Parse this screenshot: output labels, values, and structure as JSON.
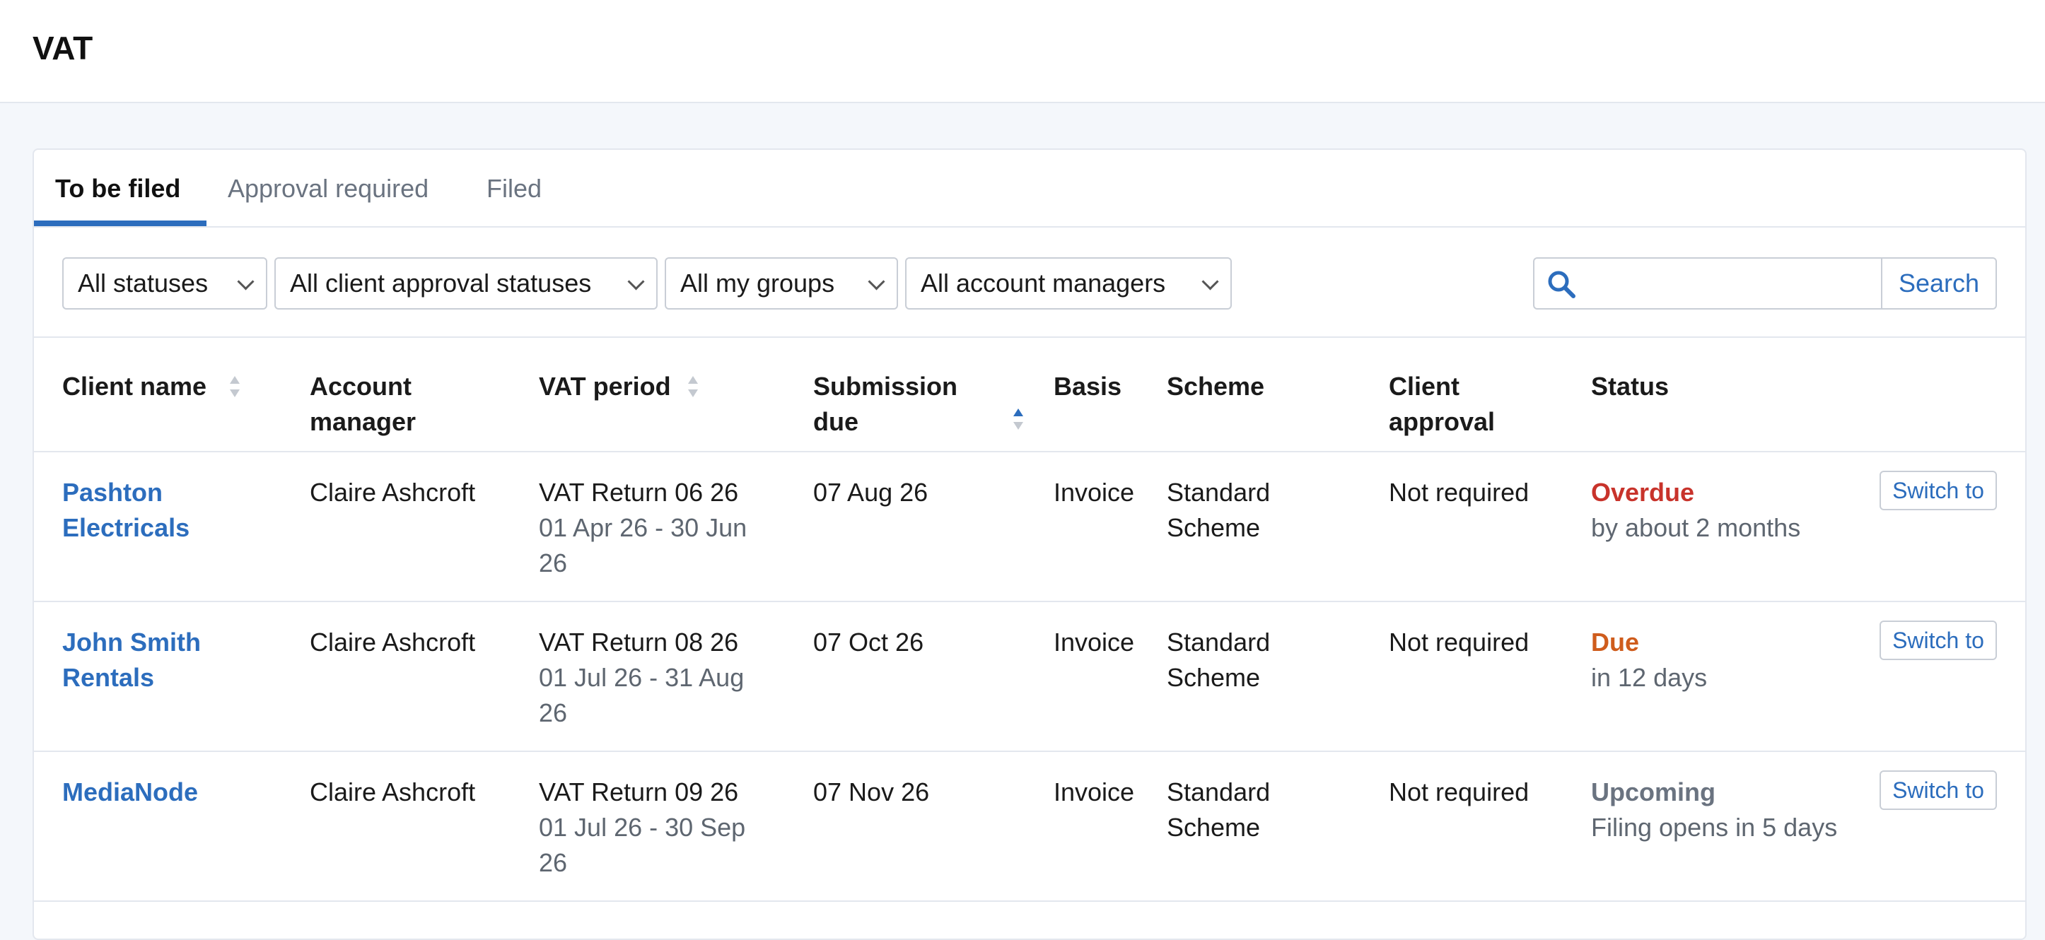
{
  "page": {
    "title": "VAT"
  },
  "tabs": [
    {
      "label": "To be filed",
      "active": true
    },
    {
      "label": "Approval required",
      "active": false
    },
    {
      "label": "Filed",
      "active": false
    }
  ],
  "filters": {
    "status": "All statuses",
    "client_approval": "All client approval statuses",
    "groups": "All my groups",
    "account_managers": "All account managers"
  },
  "search": {
    "value": "",
    "placeholder": "",
    "button_label": "Search"
  },
  "table": {
    "columns": {
      "client_name": "Client name",
      "account_manager": "Account manager",
      "vat_period": "VAT period",
      "submission_due": "Submission due",
      "basis": "Basis",
      "scheme": "Scheme",
      "client_approval": "Client approval",
      "status": "Status"
    },
    "sorted_column": "submission_due",
    "rows": [
      {
        "client": "Pashton Electricals",
        "manager": "Claire Ashcroft",
        "vat_return": "VAT Return 06 26",
        "period": "01 Apr 26 - 30 Jun 26",
        "due": "07 Aug 26",
        "basis": "Invoice",
        "scheme": "Standard Scheme",
        "approval": "Not required",
        "status": "Overdue",
        "status_detail": "by about 2 months",
        "status_color": "#c8332b",
        "action": "Switch to"
      },
      {
        "client": "John Smith Rentals",
        "manager": "Claire Ashcroft",
        "vat_return": "VAT Return 08 26",
        "period": "01 Jul 26 - 31 Aug 26",
        "due": "07 Oct 26",
        "basis": "Invoice",
        "scheme": "Standard Scheme",
        "approval": "Not required",
        "status": "Due",
        "status_detail": "in 12 days",
        "status_color": "#cf5c1c",
        "action": "Switch to"
      },
      {
        "client": "MediaNode",
        "manager": "Claire Ashcroft",
        "vat_return": "VAT Return 09 26",
        "period": "01 Jul 26 - 30 Sep 26",
        "due": "07 Nov 26",
        "basis": "Invoice",
        "scheme": "Standard Scheme",
        "approval": "Not required",
        "status": "Upcoming",
        "status_detail": "Filing opens in 5 days",
        "status_color": "#6a7380",
        "action": "Switch to"
      }
    ]
  },
  "colors": {
    "accent": "#2c6dbd",
    "overdue": "#c8332b",
    "due": "#cf5c1c",
    "upcoming": "#6a7380"
  }
}
